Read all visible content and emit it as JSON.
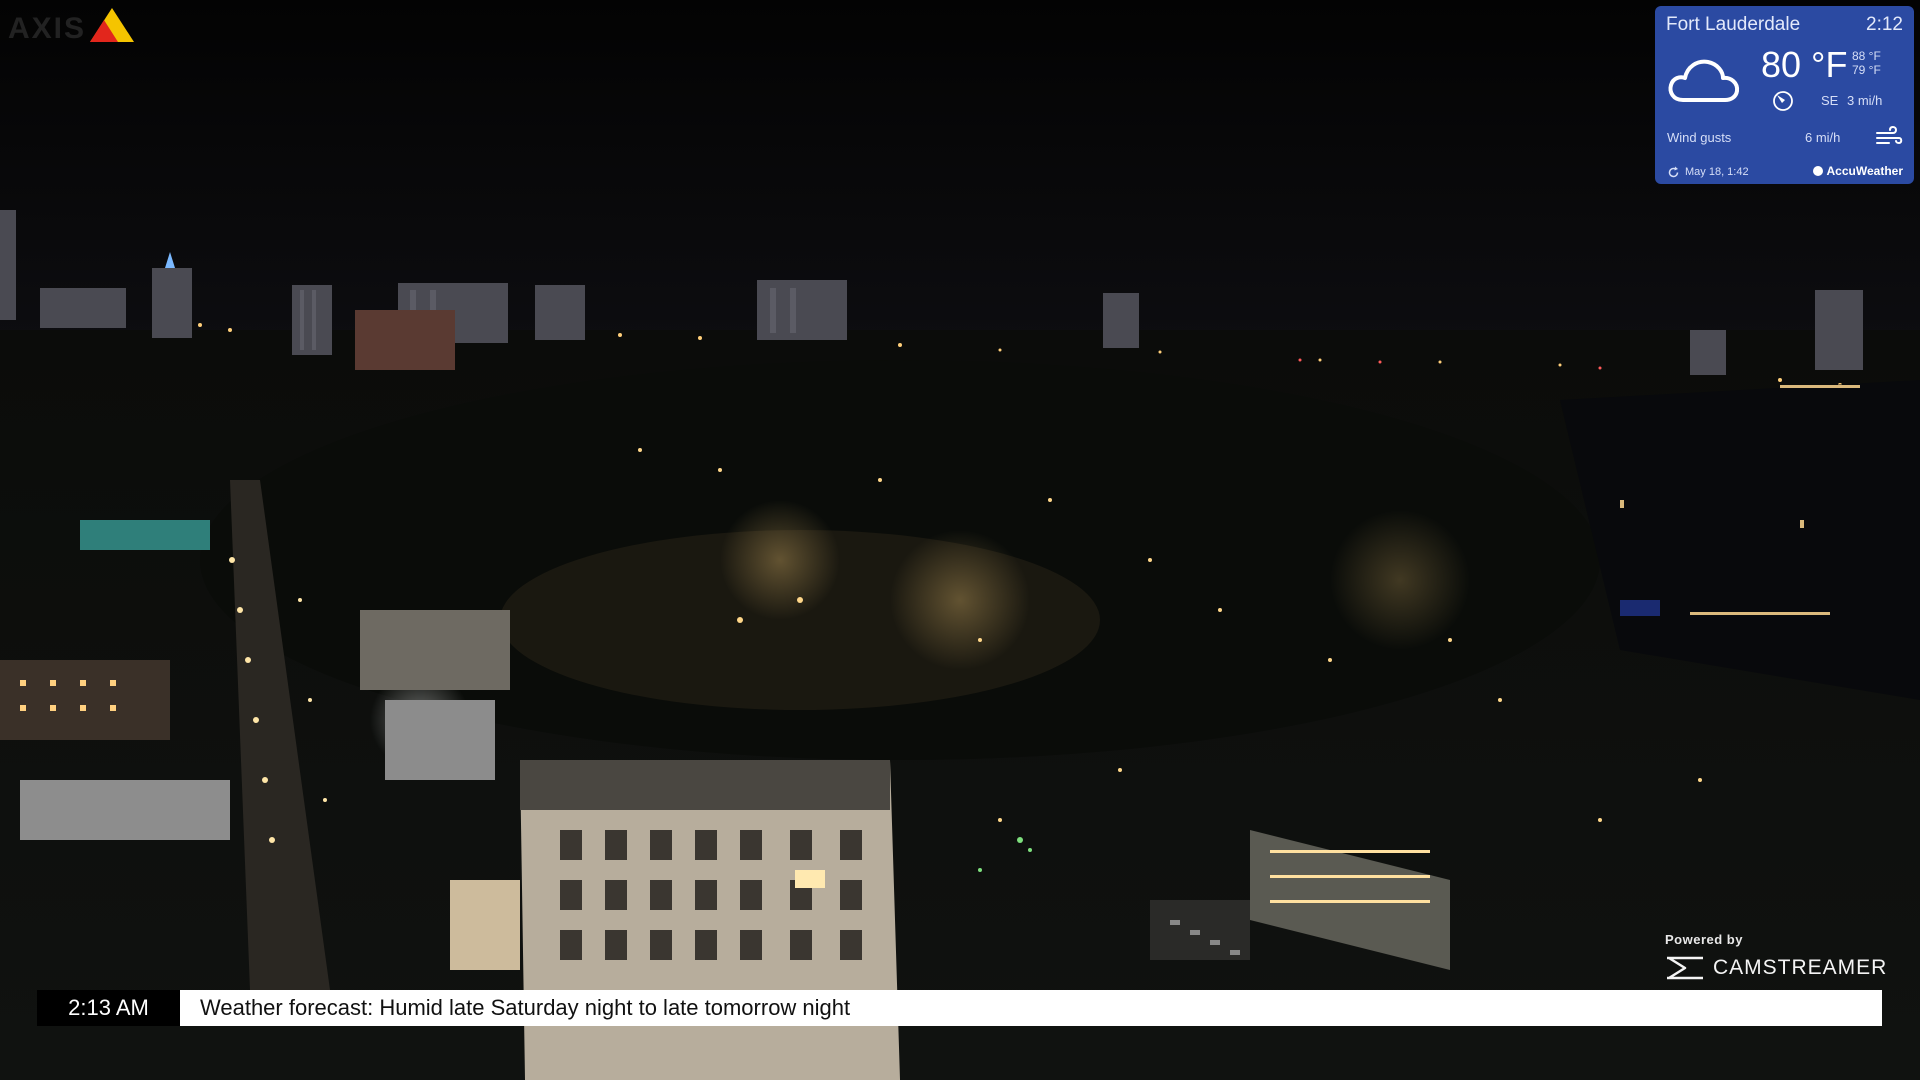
{
  "camera": {
    "logo_text": "AXIS"
  },
  "weather": {
    "city": "Fort Lauderdale",
    "time": "2:12",
    "temperature": "80 °F",
    "high": "88 °F",
    "low": "79 °F",
    "wind_direction": "SE",
    "wind_speed": "3 mi/h",
    "wind_gusts_label": "Wind gusts",
    "wind_gusts_value": "6 mi/h",
    "updated": "May 18, 1:42",
    "provider": "AccuWeather",
    "condition_icon": "cloud-icon",
    "background_color": "#2b4aa2"
  },
  "powered_by": {
    "label": "Powered by",
    "brand": "CAMSTREAMER"
  },
  "ticker": {
    "time": "2:13 AM",
    "message": "Weather forecast: Humid late Saturday night to late tomorrow night"
  }
}
